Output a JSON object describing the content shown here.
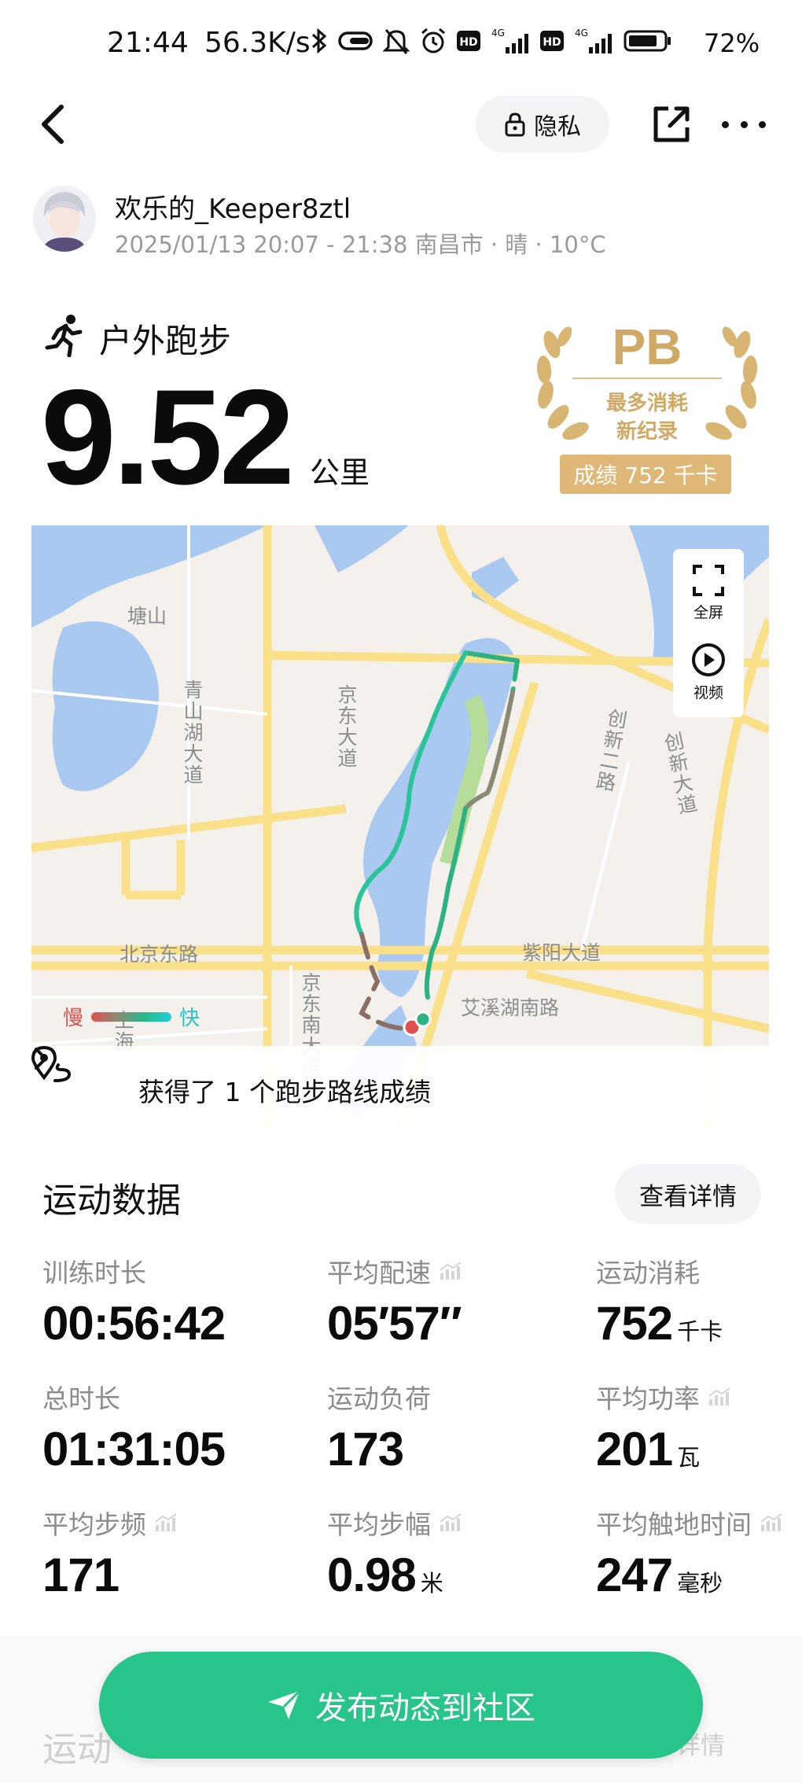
{
  "status_bar": {
    "time": "21:44",
    "net_speed": "56.3K/s",
    "signal_1": "4G",
    "signal_2": "4G",
    "battery": "72%"
  },
  "nav": {
    "privacy_label": "隐私"
  },
  "user": {
    "name": "欢乐的_Keeper8ztl",
    "meta": "2025/01/13 20:07 - 21:38 南昌市 · 晴 · 10°C"
  },
  "activity": {
    "type": "户外跑步",
    "distance": "9.52",
    "distance_unit": "公里"
  },
  "pb_badge": {
    "title": "PB",
    "line1": "最多消耗",
    "line2": "新纪录",
    "result": "成绩 752 千卡",
    "color": "#d0a966"
  },
  "map": {
    "labels": {
      "tangshan": "塘山",
      "qingshanhu": "青山湖大道",
      "jingdong": "京东大道",
      "chuangxin2": "创新二路",
      "chuangxin_ave": "创新大道",
      "beijing_east": "北京东路",
      "ziyang": "紫阳大道",
      "jingdong_south": "京东南大道",
      "aixihu": "艾溪湖南路",
      "shanghai": "上海"
    },
    "fullscreen": "全屏",
    "video": "视频",
    "legend_slow": "慢",
    "legend_fast": "快",
    "route_achievement": "获得了 1 个跑步路线成绩"
  },
  "sport_data": {
    "title": "运动数据",
    "detail_button": "查看详情",
    "stats": [
      {
        "label": "训练时长",
        "value": "00:56:42",
        "unit": "",
        "has_chart_icon": false
      },
      {
        "label": "平均配速",
        "value": "05′57″",
        "unit": "",
        "has_chart_icon": true
      },
      {
        "label": "运动消耗",
        "value": "752",
        "unit": "千卡",
        "has_chart_icon": false
      },
      {
        "label": "总时长",
        "value": "01:31:05",
        "unit": "",
        "has_chart_icon": false
      },
      {
        "label": "运动负荷",
        "value": "173",
        "unit": "",
        "has_chart_icon": false
      },
      {
        "label": "平均功率",
        "value": "201",
        "unit": "瓦",
        "has_chart_icon": true
      },
      {
        "label": "平均步频",
        "value": "171",
        "unit": "",
        "has_chart_icon": true
      },
      {
        "label": "平均步幅",
        "value": "0.98",
        "unit": "米",
        "has_chart_icon": true
      },
      {
        "label": "平均触地时间",
        "value": "247",
        "unit": "毫秒",
        "has_chart_icon": true
      }
    ]
  },
  "next_section": {
    "title": "运动",
    "detail": "详情"
  },
  "publish_button": "发布动态到社区",
  "colors": {
    "accent_green": "#27c58a",
    "pb_gold": "#dfb878"
  }
}
